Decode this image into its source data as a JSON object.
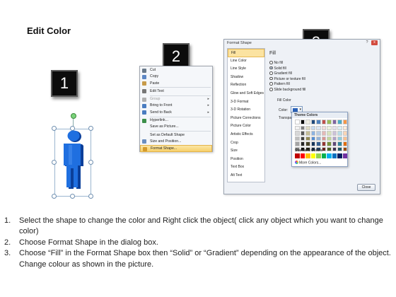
{
  "title": "Edit Color",
  "step_numbers": [
    "1",
    "2",
    "3"
  ],
  "context_menu": {
    "items": [
      {
        "label": "Cut",
        "icon": "scissors-icon",
        "color": "#6a7a8a",
        "disabled": false,
        "submenu": false,
        "highlighted": false
      },
      {
        "label": "Copy",
        "icon": "copy-icon",
        "color": "#5d87c4",
        "disabled": false,
        "submenu": false,
        "highlighted": false
      },
      {
        "label": "Paste",
        "icon": "paste-icon",
        "color": "#c79b4a",
        "disabled": false,
        "submenu": false,
        "highlighted": false
      },
      {
        "sep": true
      },
      {
        "label": "Edit Text",
        "icon": "edit-text-icon",
        "color": "#777777",
        "disabled": false,
        "submenu": false,
        "highlighted": false
      },
      {
        "sep": true
      },
      {
        "label": "Group",
        "icon": "group-icon",
        "color": "#b0b0b0",
        "disabled": true,
        "submenu": true,
        "highlighted": false
      },
      {
        "label": "Bring to Front",
        "icon": "bring-front-icon",
        "color": "#4a7cc0",
        "disabled": false,
        "submenu": true,
        "highlighted": false
      },
      {
        "label": "Send to Back",
        "icon": "send-back-icon",
        "color": "#4a7cc0",
        "disabled": false,
        "submenu": true,
        "highlighted": false
      },
      {
        "sep": true
      },
      {
        "label": "Hyperlink...",
        "icon": "hyperlink-icon",
        "color": "#3c8f4a",
        "disabled": false,
        "submenu": false,
        "highlighted": false
      },
      {
        "label": "Save as Picture...",
        "icon": "",
        "color": "",
        "disabled": false,
        "submenu": false,
        "highlighted": false
      },
      {
        "sep": true
      },
      {
        "label": "Set as Default Shape",
        "icon": "",
        "color": "",
        "disabled": false,
        "submenu": false,
        "highlighted": false
      },
      {
        "label": "Size and Position...",
        "icon": "size-position-icon",
        "color": "#6b8fbf",
        "disabled": false,
        "submenu": false,
        "highlighted": false
      },
      {
        "label": "Format Shape...",
        "icon": "format-shape-icon",
        "color": "#d49a2a",
        "disabled": false,
        "submenu": false,
        "highlighted": true
      }
    ]
  },
  "dialog": {
    "title": "Format Shape",
    "window_buttons": [
      "?",
      "x"
    ],
    "categories": [
      "Fill",
      "Line Color",
      "Line Style",
      "Shadow",
      "Reflection",
      "Glow and Soft Edges",
      "3-D Format",
      "3-D Rotation",
      "Picture Corrections",
      "Picture Color",
      "Artistic Effects",
      "Crop",
      "Size",
      "Position",
      "Text Box",
      "Alt Text"
    ],
    "selected_category": "Fill",
    "fill_heading": "Fill",
    "fill_options": [
      {
        "label": "No fill",
        "selected": false
      },
      {
        "label": "Solid fill",
        "selected": true
      },
      {
        "label": "Gradient fill",
        "selected": false
      },
      {
        "label": "Picture or texture fill",
        "selected": false
      },
      {
        "label": "Pattern fill",
        "selected": false
      },
      {
        "label": "Slide background fill",
        "selected": false
      }
    ],
    "fill_color_label": "Fill Color",
    "color_label": "Color:",
    "transparency_label": "Transpa",
    "selected_color": "#2a61b8",
    "close_label": "Close"
  },
  "palette": {
    "theme_header": "Theme Colors",
    "theme_top_row": [
      "#ffffff",
      "#000000",
      "#eeece1",
      "#1f497d",
      "#4f81bd",
      "#c0504d",
      "#9bbb59",
      "#8064a2",
      "#4bacc6",
      "#f79646"
    ],
    "theme_shades": [
      [
        "#f2f2f2",
        "#7f7f7f",
        "#ddd9c3",
        "#c6d9f0",
        "#dbe5f1",
        "#f2dcdb",
        "#ebf1dd",
        "#e5e0ec",
        "#dbeef3",
        "#fdeada"
      ],
      [
        "#d8d8d8",
        "#595959",
        "#c4bd97",
        "#8db3e2",
        "#b8cce4",
        "#e5b9b7",
        "#d7e3bc",
        "#ccc1d9",
        "#b7dde8",
        "#fbd5b5"
      ],
      [
        "#bfbfbf",
        "#3f3f3f",
        "#938953",
        "#548dd4",
        "#95b3d7",
        "#d99694",
        "#c3d69b",
        "#b2a2c7",
        "#92cddc",
        "#fac08f"
      ],
      [
        "#a5a5a5",
        "#262626",
        "#494429",
        "#17365d",
        "#366092",
        "#953734",
        "#76923c",
        "#5f497a",
        "#31859b",
        "#e36c09"
      ],
      [
        "#7f7f7f",
        "#0c0c0c",
        "#1d1b10",
        "#0f243e",
        "#244061",
        "#632423",
        "#4f6128",
        "#3f3151",
        "#205867",
        "#974806"
      ]
    ],
    "standard_header": "Standard Colors",
    "standard_colors": [
      "#c00000",
      "#ff0000",
      "#ffc000",
      "#ffff00",
      "#92d050",
      "#00b050",
      "#00b0f0",
      "#0070c0",
      "#002060",
      "#7030a0"
    ],
    "more_colors_label": "More Colors..."
  },
  "figure": {
    "body_color": "#1f6fe0",
    "dark_color": "#0b3f9a"
  },
  "instructions": [
    {
      "num": "1.",
      "text": "Select the shape to change the color and Right click the object( click any object which you want to change color)"
    },
    {
      "num": "2.",
      "text": "Choose Format Shape in the dialog box."
    },
    {
      "num": "3.",
      "text": "Choose “Fill” in the Format Shape box then “Solid” or “Gradient” depending on the appearance of the object. Change colour as shown in the picture."
    }
  ]
}
